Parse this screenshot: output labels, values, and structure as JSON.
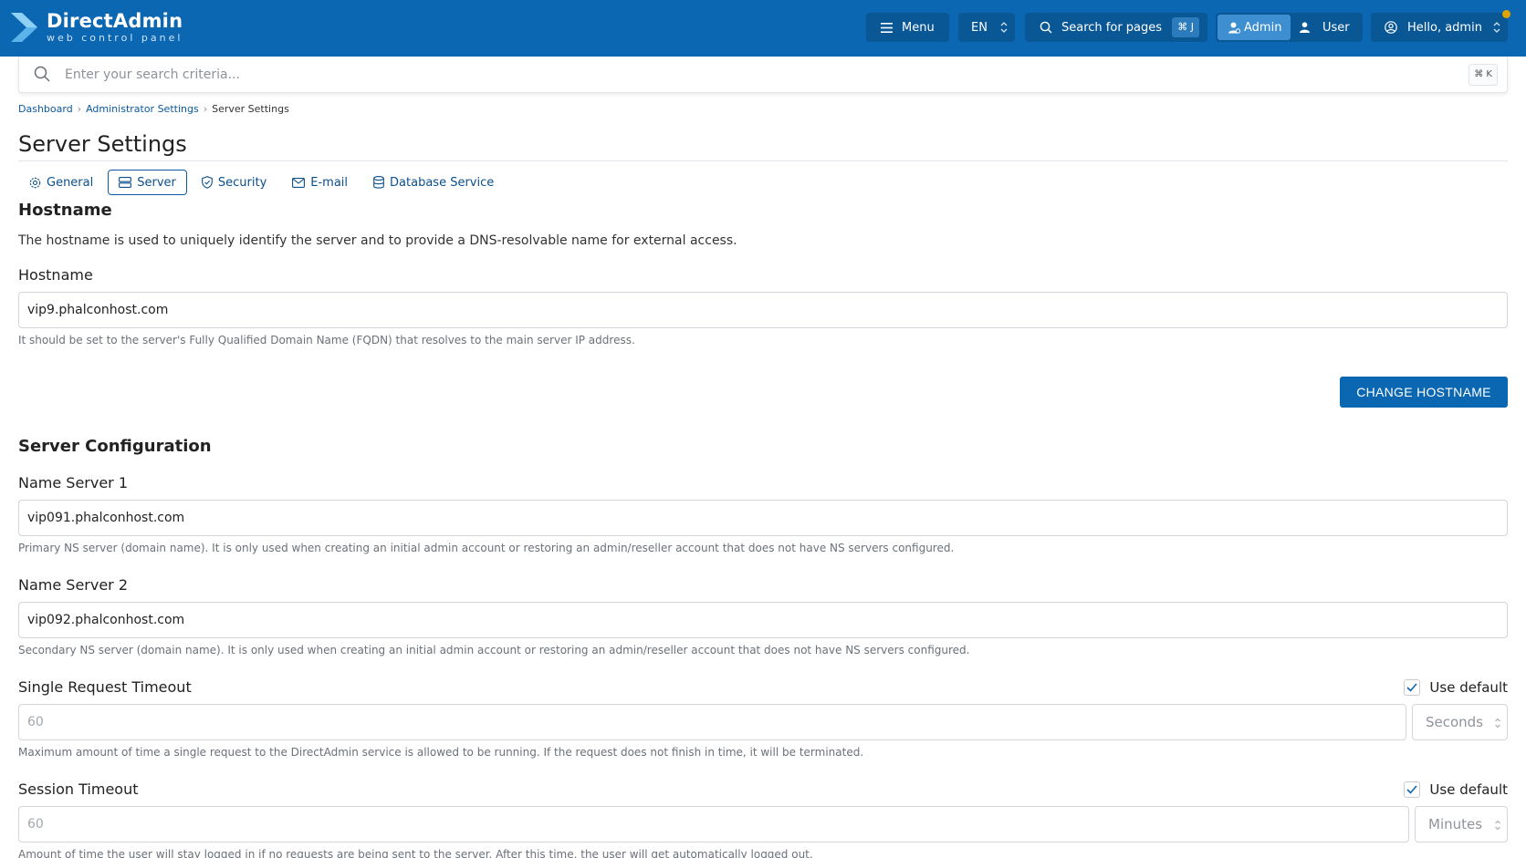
{
  "brand": {
    "name": "DirectAdmin",
    "tagline": "web control panel",
    "color": "#0b67b2"
  },
  "header": {
    "menu_label": "Menu",
    "language": "EN",
    "search_label": "Search for pages",
    "search_shortcut": "⌘ J",
    "roles": {
      "admin": "Admin",
      "user": "User",
      "active": "Admin"
    },
    "greeting": "Hello, admin"
  },
  "search": {
    "placeholder": "Enter your search criteria...",
    "shortcut": "⌘ K"
  },
  "breadcrumb": [
    "Dashboard",
    "Administrator Settings",
    "Server Settings"
  ],
  "page_title": "Server Settings",
  "tabs": [
    {
      "label": "General",
      "icon": "gear-icon"
    },
    {
      "label": "Server",
      "icon": "server-icon",
      "active": true
    },
    {
      "label": "Security",
      "icon": "shield-icon"
    },
    {
      "label": "E-mail",
      "icon": "envelope-icon"
    },
    {
      "label": "Database Service",
      "icon": "database-icon"
    }
  ],
  "hostname_section": {
    "title": "Hostname",
    "description": "The hostname is used to uniquely identify the server and to provide a DNS-resolvable name for external access.",
    "label": "Hostname",
    "value": "vip9.phalconhost.com",
    "help": "It should be set to the server's Fully Qualified Domain Name (FQDN) that resolves to the main server IP address.",
    "button": "CHANGE HOSTNAME"
  },
  "server_config": {
    "title": "Server Configuration",
    "ns1": {
      "label": "Name Server 1",
      "value": "vip091.phalconhost.com",
      "help": "Primary NS server (domain name). It is only used when creating an initial admin account or restoring an admin/reseller account that does not have NS servers configured."
    },
    "ns2": {
      "label": "Name Server 2",
      "value": "vip092.phalconhost.com",
      "help": "Secondary NS server (domain name). It is only used when creating an initial admin account or restoring an admin/reseller account that does not have NS servers configured."
    },
    "request_timeout": {
      "label": "Single Request Timeout",
      "use_default_label": "Use default",
      "use_default": true,
      "value": "60",
      "unit": "Seconds",
      "help": "Maximum amount of time a single request to the DirectAdmin service is allowed to be running. If the request does not finish in time, it will be terminated."
    },
    "session_timeout": {
      "label": "Session Timeout",
      "use_default_label": "Use default",
      "use_default": true,
      "value": "60",
      "unit": "Minutes",
      "help": "Amount of time the user will stay logged in if no requests are being sent to the server. After this time, the user will get automatically logged out."
    }
  }
}
